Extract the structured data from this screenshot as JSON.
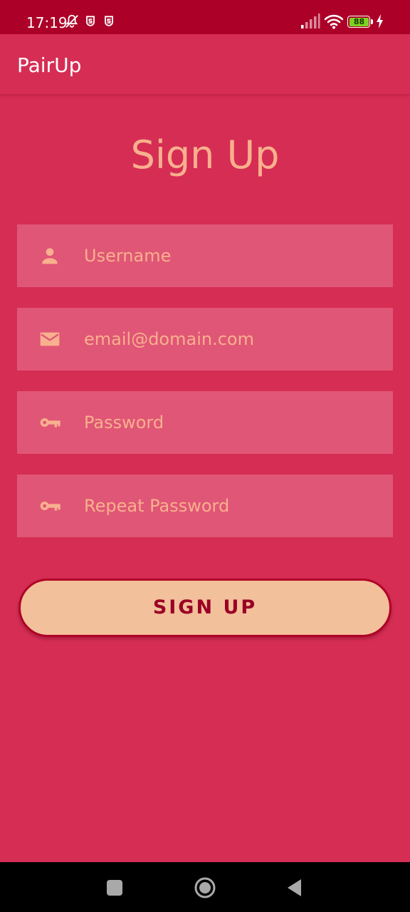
{
  "status_bar": {
    "time": "17:19",
    "battery_level": "88",
    "icons": [
      "notifications-muted-icon",
      "app-notification-icon",
      "app-notification-icon",
      "signal-icon",
      "wifi-icon",
      "battery-icon",
      "charging-icon"
    ]
  },
  "app_bar": {
    "title": "PairUp"
  },
  "form": {
    "title": "Sign Up",
    "fields": [
      {
        "icon": "person-icon",
        "placeholder": "Username",
        "value": ""
      },
      {
        "icon": "email-icon",
        "placeholder": "email@domain.com",
        "value": ""
      },
      {
        "icon": "key-icon",
        "placeholder": "Password",
        "value": ""
      },
      {
        "icon": "key-icon",
        "placeholder": "Repeat Password",
        "value": ""
      }
    ],
    "submit_label": "SIGN UP"
  },
  "nav_bar": {
    "buttons": [
      "recents-button",
      "home-button",
      "back-button"
    ]
  },
  "colors": {
    "background": "#d62d54",
    "status_bar": "#ad0028",
    "field_background": "#e05676",
    "accent_text": "#f8b08e",
    "button_background": "#f2c09b",
    "button_text": "#9a0025"
  }
}
